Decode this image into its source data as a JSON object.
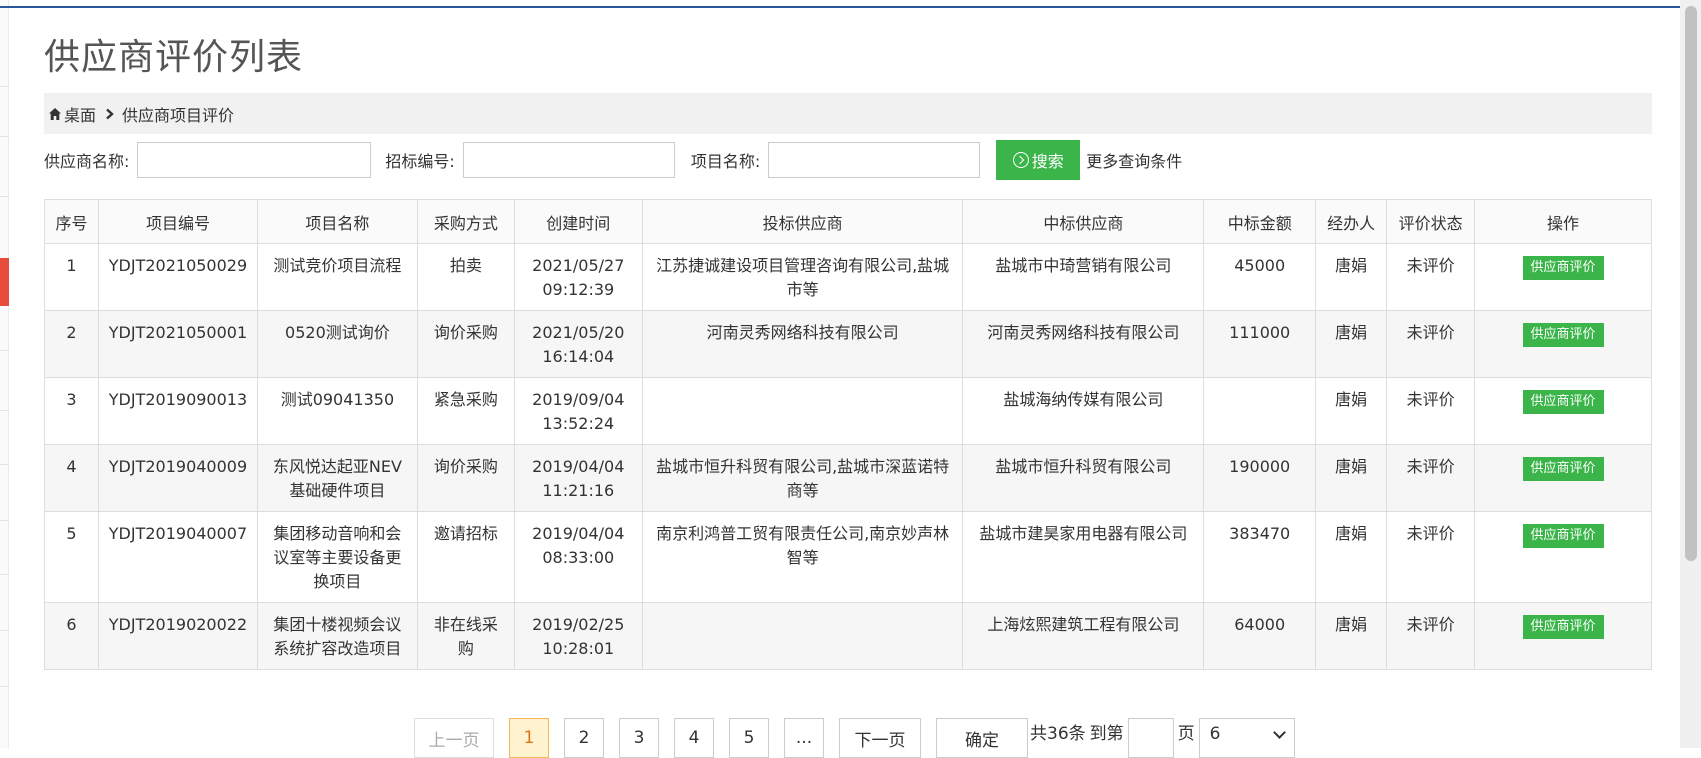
{
  "page": {
    "title": "供应商评价列表"
  },
  "breadcrumb": {
    "home": "桌面",
    "current": "供应商项目评价"
  },
  "search": {
    "supplier_label": "供应商名称:",
    "supplier_value": "",
    "bid_no_label": "招标编号:",
    "bid_no_value": "",
    "project_label": "项目名称:",
    "project_value": "",
    "search_button": "搜索",
    "more_conditions": "更多查询条件"
  },
  "table": {
    "headers": [
      "序号",
      "项目编号",
      "项目名称",
      "采购方式",
      "创建时间",
      "投标供应商",
      "中标供应商",
      "中标金额",
      "经办人",
      "评价状态",
      "操作"
    ],
    "rows": [
      {
        "no": "1",
        "code": "YDJT2021050029",
        "name": "测试竞价项目流程",
        "method": "拍卖",
        "created": "2021/05/27 09:12:39",
        "bidders": "江苏捷诚建设项目管理咨询有限公司,盐城市等",
        "winner": "盐城市中琦营销有限公司",
        "amount": "45000",
        "handler": "唐娟",
        "status": "未评价",
        "action": "供应商评价"
      },
      {
        "no": "2",
        "code": "YDJT2021050001",
        "name": "0520测试询价",
        "method": "询价采购",
        "created": "2021/05/20 16:14:04",
        "bidders": "河南灵秀网络科技有限公司",
        "winner": "河南灵秀网络科技有限公司",
        "amount": "111000",
        "handler": "唐娟",
        "status": "未评价",
        "action": "供应商评价"
      },
      {
        "no": "3",
        "code": "YDJT2019090013",
        "name": "测试09041350",
        "method": "紧急采购",
        "created": "2019/09/04 13:52:24",
        "bidders": "",
        "winner": "盐城海纳传媒有限公司",
        "amount": "",
        "handler": "唐娟",
        "status": "未评价",
        "action": "供应商评价"
      },
      {
        "no": "4",
        "code": "YDJT2019040009",
        "name": "东风悦达起亚NEV基础硬件项目",
        "method": "询价采购",
        "created": "2019/04/04 11:21:16",
        "bidders": "盐城市恒升科贸有限公司,盐城市深蓝诺特商等",
        "winner": "盐城市恒升科贸有限公司",
        "amount": "190000",
        "handler": "唐娟",
        "status": "未评价",
        "action": "供应商评价"
      },
      {
        "no": "5",
        "code": "YDJT2019040007",
        "name": "集团移动音响和会议室等主要设备更换项目",
        "method": "邀请招标",
        "created": "2019/04/04 08:33:00",
        "bidders": "南京利鸿普工贸有限责任公司,南京妙声林智等",
        "winner": "盐城市建昊家用电器有限公司",
        "amount": "383470",
        "handler": "唐娟",
        "status": "未评价",
        "action": "供应商评价"
      },
      {
        "no": "6",
        "code": "YDJT2019020022",
        "name": "集团十楼视频会议系统扩容改造项目",
        "method": "非在线采购",
        "created": "2019/02/25 10:28:01",
        "bidders": "",
        "winner": "上海炫熙建筑工程有限公司",
        "amount": "64000",
        "handler": "唐娟",
        "status": "未评价",
        "action": "供应商评价"
      }
    ]
  },
  "pager": {
    "prev": "上一页",
    "pages": [
      "1",
      "2",
      "3",
      "4",
      "5",
      "..."
    ],
    "current": "1",
    "next": "下一页",
    "confirm": "确定",
    "total": "共36条",
    "goto": "到第",
    "goto_value": "",
    "page_unit": "页",
    "page_size": "6"
  },
  "colors": {
    "accent_green": "#3bb54a",
    "topline": "#2b579a",
    "active_page": "#e0721a"
  },
  "icons": {
    "home": "home-icon",
    "breadcrumb_sep": "chevron-right-icon",
    "search": "circle-arrow-right-icon",
    "select": "chevron-down-icon"
  }
}
